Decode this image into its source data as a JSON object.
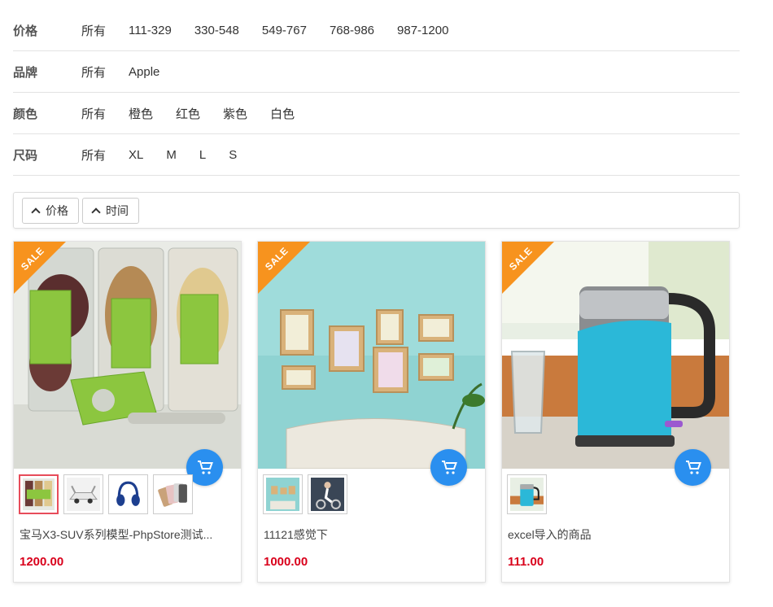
{
  "filters": [
    {
      "label": "价格",
      "options": [
        "所有",
        "111-329",
        "330-548",
        "549-767",
        "768-986",
        "987-1200"
      ]
    },
    {
      "label": "品牌",
      "options": [
        "所有",
        "Apple"
      ]
    },
    {
      "label": "颜色",
      "options": [
        "所有",
        "橙色",
        "红色",
        "紫色",
        "白色"
      ]
    },
    {
      "label": "尺码",
      "options": [
        "所有",
        "XL",
        "M",
        "L",
        "S"
      ]
    }
  ],
  "sort": {
    "price_label": "价格",
    "time_label": "时间"
  },
  "products": [
    {
      "badge": "SALE",
      "image": "storage-jars",
      "thumbs": [
        "storage-jars",
        "white-car",
        "blue-headphones",
        "phones"
      ],
      "title": "宝马X3-SUV系列模型-PhpStore测试...",
      "price": "1200.00"
    },
    {
      "badge": "SALE",
      "image": "photo-frames",
      "thumbs": [
        "photo-frames",
        "exercise-bike"
      ],
      "title": "11121感觉下",
      "price": "1000.00"
    },
    {
      "badge": "SALE",
      "image": "electric-kettle",
      "thumbs": [
        "electric-kettle"
      ],
      "title": "excel导入的商品",
      "price": "111.00"
    }
  ],
  "colors": {
    "accent": "#2a8fef",
    "sale": "#f7931e",
    "price": "#d9001b"
  }
}
